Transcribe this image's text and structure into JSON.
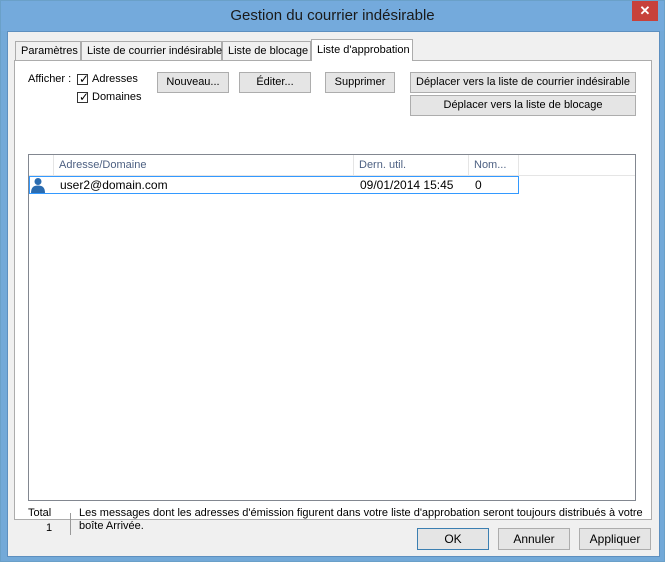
{
  "window": {
    "title": "Gestion du courrier indésirable",
    "close_label": "✕"
  },
  "tabs": [
    {
      "label": "Paramètres"
    },
    {
      "label": "Liste de courrier indésirable"
    },
    {
      "label": "Liste de blocage"
    },
    {
      "label": "Liste d'approbation"
    }
  ],
  "filter": {
    "label": "Afficher :",
    "addresses": {
      "label": "Adresses",
      "checked": true
    },
    "domains": {
      "label": "Domaines",
      "checked": true
    }
  },
  "actions": {
    "new": "Nouveau...",
    "edit": "Éditer...",
    "delete": "Supprimer",
    "move_junk": "Déplacer vers la liste de courrier indésirable",
    "move_block": "Déplacer vers la liste de blocage"
  },
  "list": {
    "columns": [
      "Adresse/Domaine",
      "Dern. util.",
      "Nom..."
    ],
    "rows": [
      {
        "address": "user2@domain.com",
        "last_used": "09/01/2014 15:45",
        "count": "0",
        "icon": "user-icon"
      }
    ]
  },
  "footer": {
    "total_label": "Total",
    "total_value": "1",
    "info_line1": "Les messages dont les adresses d'émission figurent dans votre liste d'approbation seront toujours distribués à votre",
    "info_line2": "boîte Arrivée."
  },
  "buttons": {
    "ok": "OK",
    "cancel": "Annuler",
    "apply": "Appliquer"
  }
}
